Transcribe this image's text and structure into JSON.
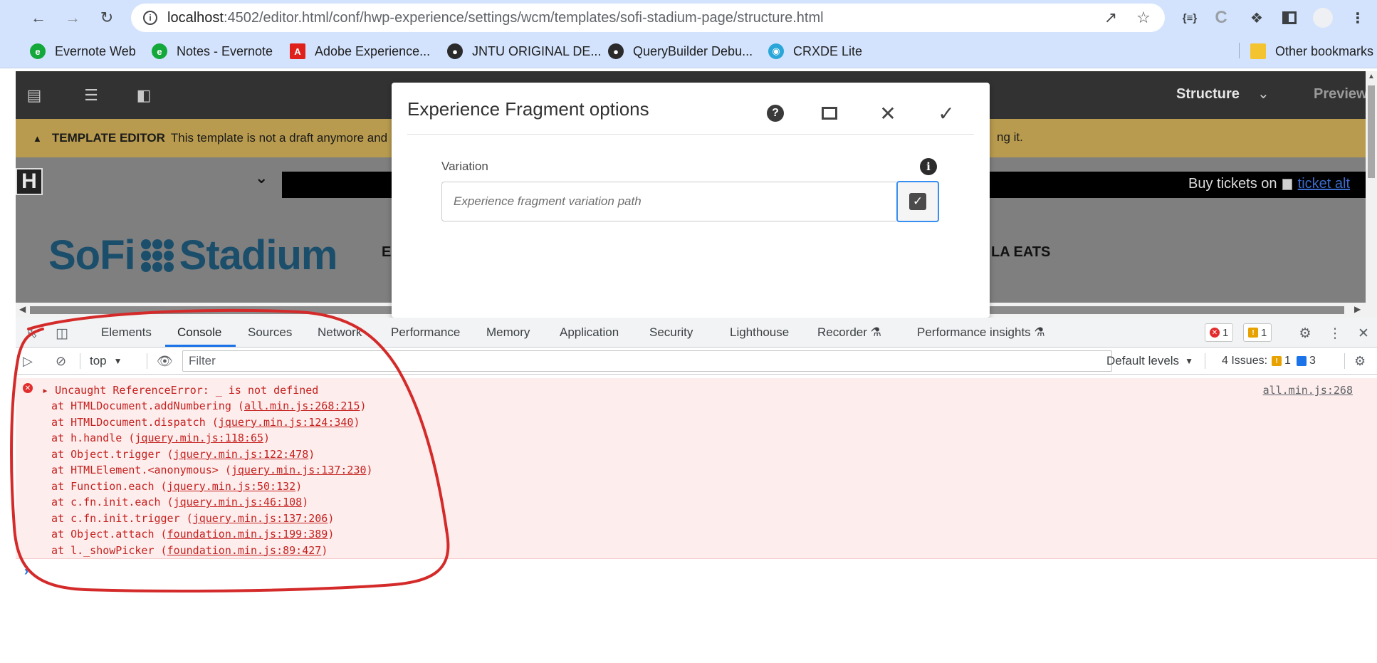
{
  "browser": {
    "url_host": "localhost",
    "url_rest": ":4502/editor.html/conf/hwp-experience/settings/wcm/templates/sofi-stadium-page/structure.html",
    "extension_label": "{≡}",
    "ext_c_label": "C",
    "bookmarks": [
      {
        "label": "Evernote Web"
      },
      {
        "label": "Notes - Evernote"
      },
      {
        "label": "Adobe Experience..."
      },
      {
        "label": "JNTU ORIGINAL DE..."
      },
      {
        "label": "QueryBuilder Debu..."
      },
      {
        "label": "CRXDE Lite"
      }
    ],
    "other_bookmarks": "Other bookmarks"
  },
  "editor": {
    "mode_label": "Structure",
    "preview_label": "Preview",
    "template_label": "TEMPLATE EDITOR",
    "template_message": "This template is not a draft anymore and",
    "template_message_tail": "ng it.",
    "site_logo_letter": "H",
    "buy_tickets": "Buy tickets on",
    "ticket_alt": "ticket alt",
    "brand_left": "SoFi",
    "brand_right": "Stadium",
    "nav_frag_left": "E",
    "nav_frag_right": "LA EATS"
  },
  "dialog": {
    "title": "Experience Fragment options",
    "field_label": "Variation",
    "field_placeholder": "Experience fragment variation path"
  },
  "devtools": {
    "tabs": [
      "Elements",
      "Console",
      "Sources",
      "Network",
      "Performance",
      "Memory",
      "Application",
      "Security",
      "Lighthouse",
      "Recorder",
      "Performance insights"
    ],
    "active_tab": "Console",
    "error_count": "1",
    "warning_count": "1",
    "context": "top",
    "filter_placeholder": "Filter",
    "levels": "Default levels",
    "issues_label": "4 Issues:",
    "issues_warn": "1",
    "issues_info": "3"
  },
  "console": {
    "error_title": "Uncaught ReferenceError: _ is not defined",
    "source": "all.min.js:268",
    "stack": [
      {
        "pre": "at HTMLDocument.addNumbering (",
        "link": "all.min.js:268:215",
        "post": ")"
      },
      {
        "pre": "at HTMLDocument.dispatch (",
        "link": "jquery.min.js:124:340",
        "post": ")"
      },
      {
        "pre": "at h.handle (",
        "link": "jquery.min.js:118:65",
        "post": ")"
      },
      {
        "pre": "at Object.trigger (",
        "link": "jquery.min.js:122:478",
        "post": ")"
      },
      {
        "pre": "at HTMLElement.<anonymous> (",
        "link": "jquery.min.js:137:230",
        "post": ")"
      },
      {
        "pre": "at Function.each (",
        "link": "jquery.min.js:50:132",
        "post": ")"
      },
      {
        "pre": "at c.fn.init.each (",
        "link": "jquery.min.js:46:108",
        "post": ")"
      },
      {
        "pre": "at c.fn.init.trigger (",
        "link": "jquery.min.js:137:206",
        "post": ")"
      },
      {
        "pre": "at Object.attach (",
        "link": "foundation.min.js:199:389",
        "post": ")"
      },
      {
        "pre": "at l._showPicker (",
        "link": "foundation.min.js:89:427",
        "post": ")"
      }
    ]
  },
  "colors": {
    "chrome_bg": "#d3e3fd",
    "toolbar_dark": "#323232",
    "template_bar": "#b89b4e",
    "error_bg": "#fdeded",
    "error_text": "#c5221f",
    "annotation_red": "#d42a2a",
    "picker_blue": "#378ef0"
  }
}
